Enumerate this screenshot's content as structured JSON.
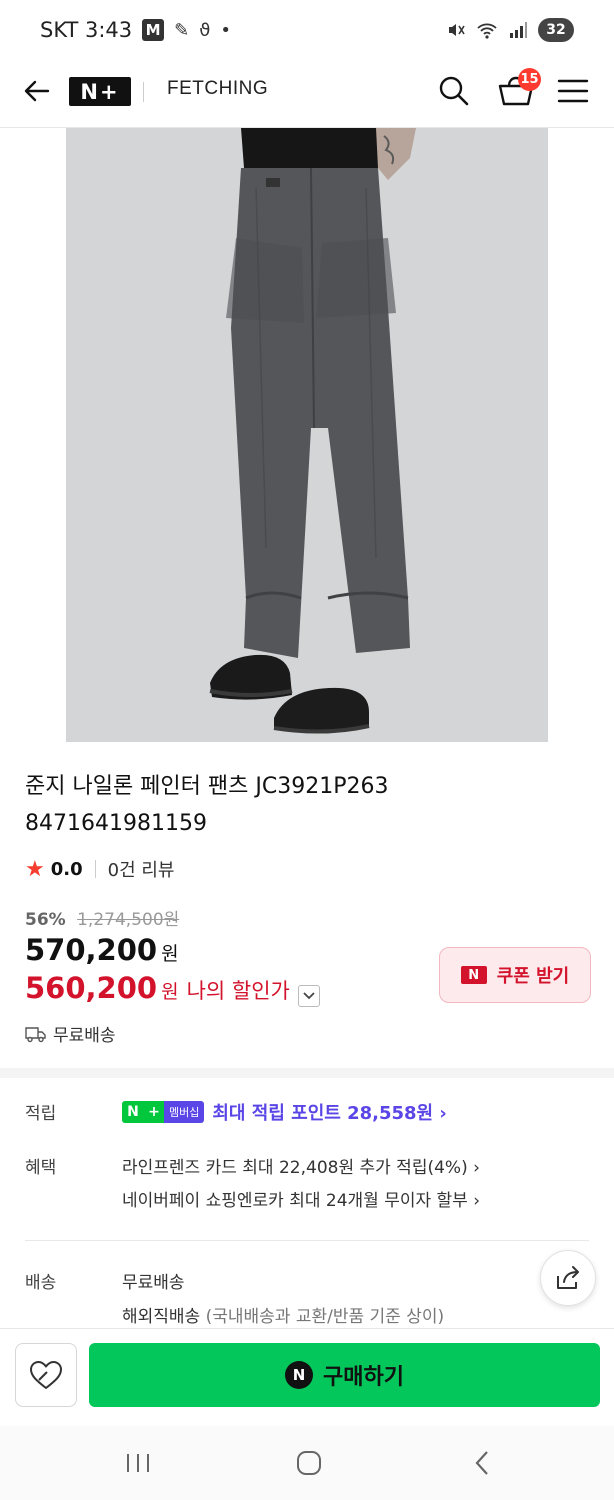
{
  "status_bar": {
    "carrier_time": "SKT 3:43",
    "m_icon": "M",
    "battery": "32",
    "icons": [
      "mute-icon",
      "wifi-icon",
      "signal-icon"
    ]
  },
  "header": {
    "logo": "N+",
    "store_name": "FETCHING",
    "cart_count": "15"
  },
  "product": {
    "title_line1": "준지 나일론 페인터 팬츠 JC3921P263",
    "title_line2": "8471641981159",
    "rating": "0.0",
    "review_count": "0건 리뷰",
    "discount_rate": "56%",
    "original_price": "1,274,500원",
    "price": "570,200",
    "price_unit": "원",
    "my_price": "560,200",
    "my_price_unit": "원",
    "my_price_label": "나의 할인가",
    "coupon_label": "쿠폰 받기",
    "coupon_badge": "N",
    "shipping": "무료배송"
  },
  "info": {
    "points_label": "적립",
    "membership_badge_n": "N",
    "membership_badge_plus": "+",
    "membership_badge_text": "멤버십",
    "points_text": "최대 적립 포인트 28,558원 ›",
    "benefit_label": "혜택",
    "benefit_1": "라인프렌즈 카드 최대 22,408원 추가 적립(4%) ›",
    "benefit_2": "네이버페이 쇼핑엔로카 최대 24개월 무이자 할부 ›",
    "delivery_label": "배송",
    "delivery_1": "무료배송",
    "delivery_2_main": "해외직배송",
    "delivery_2_sub": " (국내배송과 교환/반품 기준 상이)"
  },
  "bottom": {
    "buy_badge": "N",
    "buy_label": "구매하기"
  },
  "colors": {
    "accent_red": "#d3132c",
    "naver_green": "#03c75a",
    "membership_purple": "#5a46e6"
  }
}
